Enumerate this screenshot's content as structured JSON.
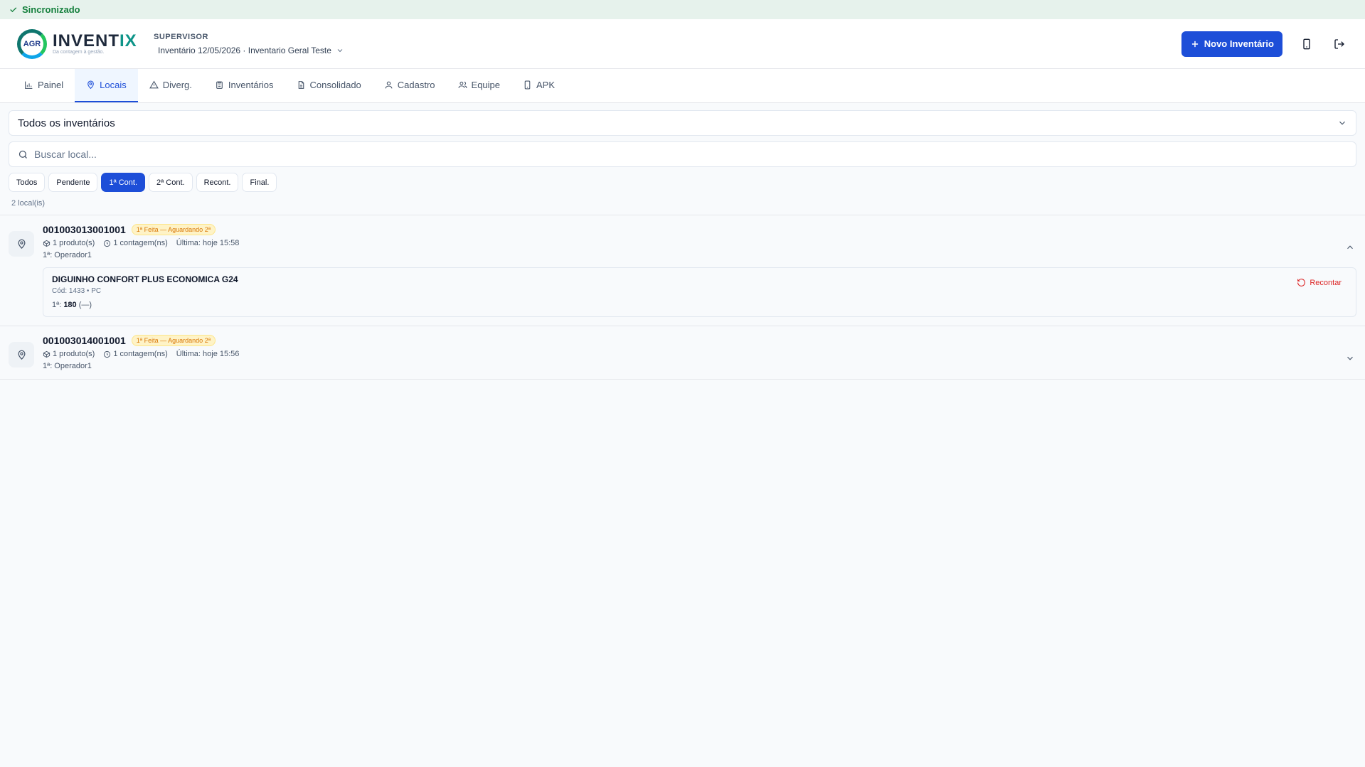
{
  "sync": {
    "label": "Sincronizado"
  },
  "header": {
    "logo_badge": "AGR",
    "logo_name_main": "INVENT",
    "logo_name_accent": "IX",
    "logo_tagline": "Da contagem à gestão.",
    "role": "SUPERVISOR",
    "inventory_selected": "Inventário 12/05/2026 · Inventario Geral Teste",
    "new_button": "Novo Inventário"
  },
  "tabs": [
    {
      "label": "Painel",
      "icon": "bar-chart-icon"
    },
    {
      "label": "Locais",
      "icon": "map-pin-icon",
      "active": true
    },
    {
      "label": "Diverg.",
      "icon": "warning-icon"
    },
    {
      "label": "Inventários",
      "icon": "clipboard-icon"
    },
    {
      "label": "Consolidado",
      "icon": "document-icon"
    },
    {
      "label": "Cadastro",
      "icon": "user-icon"
    },
    {
      "label": "Equipe",
      "icon": "users-icon"
    },
    {
      "label": "APK",
      "icon": "smartphone-icon"
    }
  ],
  "filter_select": {
    "value": "Todos os inventários"
  },
  "search": {
    "placeholder": "Buscar local..."
  },
  "chips": [
    {
      "label": "Todos"
    },
    {
      "label": "Pendente"
    },
    {
      "label": "1ª Cont.",
      "active": true
    },
    {
      "label": "2ª Cont."
    },
    {
      "label": "Recont."
    },
    {
      "label": "Final."
    }
  ],
  "count_text": "2 local(is)",
  "locations": [
    {
      "code": "001003013001001",
      "status": "1ª Feita — Aguardando 2ª",
      "products": "1 produto(s)",
      "counts": "1 contagem(ns)",
      "last": "Última: hoje 15:58",
      "operator": "1ª: Operador1",
      "expanded": true,
      "product_detail": {
        "name": "DIGUINHO CONFORT PLUS ECONOMICA G24",
        "sub": "Cód: 1433 • PC",
        "count_label": "1ª:",
        "count_value": "180",
        "count_extra": "(—)",
        "recount_label": "Recontar"
      }
    },
    {
      "code": "001003014001001",
      "status": "1ª Feita — Aguardando 2ª",
      "products": "1 produto(s)",
      "counts": "1 contagem(ns)",
      "last": "Última: hoje 15:56",
      "operator": "1ª: Operador1",
      "expanded": false
    }
  ],
  "colors": {
    "primary": "#1d4ed8",
    "sync_bg": "#e6f2ec",
    "sync_text": "#15803d",
    "badge_bg": "#fef3c7",
    "badge_text": "#d97706",
    "recount": "#dc2626"
  }
}
